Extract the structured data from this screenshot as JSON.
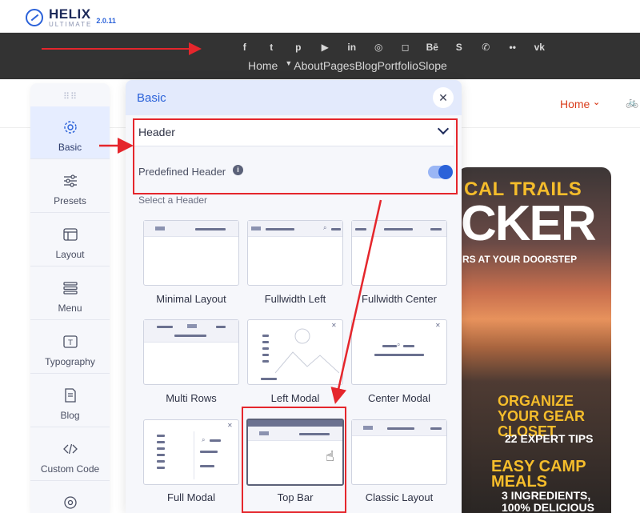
{
  "topbar": {
    "logo_name": "HELIX",
    "logo_sub": "ULTIMATE",
    "version": "2.0.11"
  },
  "dark_header": {
    "social_icons": [
      "facebook-icon",
      "twitter-icon",
      "pinterest-icon",
      "youtube-icon",
      "linkedin-icon",
      "dribbble-icon",
      "instagram-icon",
      "behance-icon",
      "skype-icon",
      "whatsapp-icon",
      "flickr-icon",
      "vk-icon"
    ],
    "social_glyphs": [
      "f",
      "t",
      "p",
      "▶",
      "in",
      "◎",
      "◻",
      "Bē",
      "S",
      "✆",
      "••",
      "vk"
    ],
    "nav": [
      "Home",
      "About",
      "Pages",
      "Blog",
      "Portfolio",
      "Slope"
    ]
  },
  "site_nav": {
    "home": "Home",
    "caret": "⌄"
  },
  "sidebar": {
    "items": [
      {
        "label": "Basic",
        "icon": "gear-icon"
      },
      {
        "label": "Presets",
        "icon": "sliders-icon"
      },
      {
        "label": "Layout",
        "icon": "layout-icon"
      },
      {
        "label": "Menu",
        "icon": "menu-icon"
      },
      {
        "label": "Typography",
        "icon": "typography-icon"
      },
      {
        "label": "Blog",
        "icon": "blog-icon"
      },
      {
        "label": "Custom Code",
        "icon": "code-icon"
      }
    ]
  },
  "panel": {
    "title": "Basic",
    "close": "✕",
    "section": "Header",
    "predefined_label": "Predefined Header",
    "info": "i",
    "predefined_enabled": true,
    "select_label": "Select a Header",
    "layouts": [
      {
        "name": "Minimal Layout"
      },
      {
        "name": "Fullwidth Left"
      },
      {
        "name": "Fullwidth Center"
      },
      {
        "name": "Multi Rows"
      },
      {
        "name": "Left Modal"
      },
      {
        "name": "Center Modal"
      },
      {
        "name": "Full Modal"
      },
      {
        "name": "Top Bar"
      },
      {
        "name": "Classic Layout"
      }
    ],
    "selected_layout": "Top Bar"
  },
  "cover": {
    "line1": "CAL TRAILS",
    "line2": "CKER",
    "line3": "RS AT YOUR DOORSTEP",
    "blurb1": "ORGANIZE\nYOUR GEAR\nCLOSET",
    "blurb2": "22 EXPERT TIPS",
    "blurb3": "EASY CAMP\nMEALS",
    "blurb4": "3 INGREDIENTS,\n100% DELICIOUS"
  },
  "colors": {
    "accent": "#2b62d9",
    "annotation": "#e5262c",
    "dark_bar": "#333333",
    "site_link": "#d93c1b"
  }
}
